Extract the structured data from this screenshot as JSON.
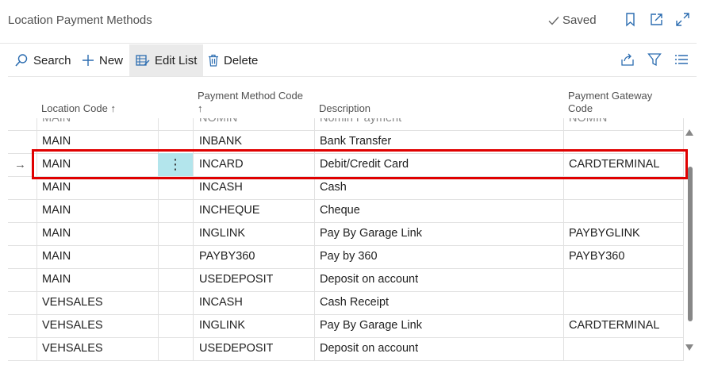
{
  "header": {
    "title": "Location Payment Methods",
    "saved_label": "Saved"
  },
  "actions": {
    "search": "Search",
    "new": "New",
    "edit_list": "Edit List",
    "delete": "Delete"
  },
  "columns": {
    "location": "Location Code ↑",
    "pm_code": "Payment Method Code",
    "pm_code_sort": "↑",
    "description": "Description",
    "gateway_line1": "Payment Gateway",
    "gateway_line2": "Code"
  },
  "partial_row": {
    "location": "MAIN",
    "pm_code": "NOMIN",
    "description": "Nomin Payment",
    "gateway": "NOMIN"
  },
  "rows": [
    {
      "location": "MAIN",
      "pm_code": "INBANK",
      "description": "Bank Transfer",
      "gateway": ""
    },
    {
      "location": "MAIN",
      "pm_code": "INCARD",
      "description": "Debit/Credit Card",
      "gateway": "CARDTERMINAL"
    },
    {
      "location": "MAIN",
      "pm_code": "INCASH",
      "description": "Cash",
      "gateway": ""
    },
    {
      "location": "MAIN",
      "pm_code": "INCHEQUE",
      "description": "Cheque",
      "gateway": ""
    },
    {
      "location": "MAIN",
      "pm_code": "INGLINK",
      "description": "Pay By Garage Link",
      "gateway": "PAYBYGLINK"
    },
    {
      "location": "MAIN",
      "pm_code": "PAYBY360",
      "description": "Pay by 360",
      "gateway": "PAYBY360"
    },
    {
      "location": "MAIN",
      "pm_code": "USEDEPOSIT",
      "description": "Deposit on account",
      "gateway": ""
    },
    {
      "location": "VEHSALES",
      "pm_code": "INCASH",
      "description": "Cash Receipt",
      "gateway": ""
    },
    {
      "location": "VEHSALES",
      "pm_code": "INGLINK",
      "description": "Pay By Garage Link",
      "gateway": "CARDTERMINAL"
    },
    {
      "location": "VEHSALES",
      "pm_code": "USEDEPOSIT",
      "description": "Deposit on account",
      "gateway": ""
    }
  ],
  "selected_row_index": 1,
  "icons": [
    "checkmark-icon",
    "bookmark-icon",
    "open-new-window-icon",
    "expand-icon",
    "search-icon",
    "plus-icon",
    "edit-list-icon",
    "trash-icon",
    "share-icon",
    "filter-icon",
    "list-view-icon",
    "row-arrow-icon",
    "row-menu-dots-icon"
  ],
  "colors": {
    "selection_border": "#e00000",
    "dots_highlight": "#b3e5ec"
  }
}
